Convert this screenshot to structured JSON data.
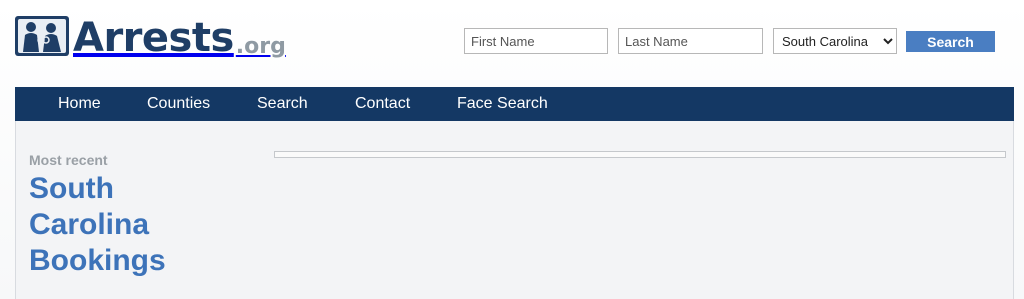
{
  "brand": {
    "name": "Arrests",
    "tld": ".org",
    "logo_icon": "handcuffed-figures-icon",
    "colors": {
      "primary": "#1f3e66",
      "tld": "#8f9aa3"
    }
  },
  "search": {
    "first_name_placeholder": "First Name",
    "last_name_placeholder": "Last Name",
    "state_selected": "South Carolina",
    "button_label": "Search",
    "button_color": "#4a7ec2"
  },
  "nav": {
    "background": "#143864",
    "items": [
      {
        "label": "Home"
      },
      {
        "label": "Counties"
      },
      {
        "label": "Search"
      },
      {
        "label": "Contact"
      },
      {
        "label": "Face Search"
      }
    ]
  },
  "main": {
    "eyebrow": "Most recent",
    "title": "South Carolina Bookings",
    "title_color": "#3d73b9"
  }
}
